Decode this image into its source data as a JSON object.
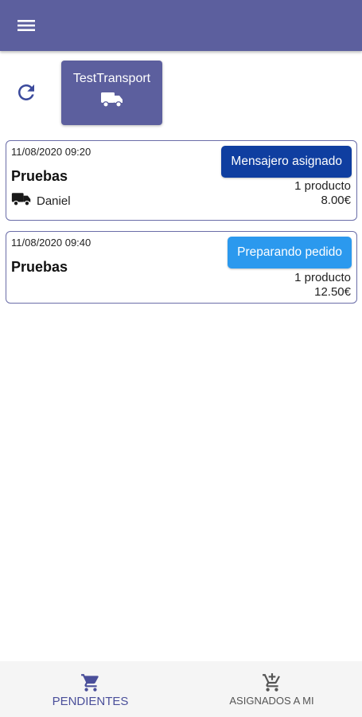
{
  "appbar": {
    "menu_icon": "menu-icon"
  },
  "toolbar": {
    "refresh_icon": "refresh-icon"
  },
  "transport": {
    "label": "TestTransport",
    "icon": "truck-icon"
  },
  "orders": [
    {
      "date": "11/08/2020 09:20",
      "name": "Pruebas",
      "status": "Mensajero asignado",
      "status_color": "#0f3ea0",
      "count": "1 producto",
      "price": "8.00€",
      "courier": "Daniel",
      "courier_icon": "truck-icon"
    },
    {
      "date": "11/08/2020 09:40",
      "name": "Pruebas",
      "status": "Preparando pedido",
      "status_color": "#2b99ee",
      "count": "1 producto",
      "price": "12.50€"
    }
  ],
  "bottom_nav": {
    "items": [
      {
        "label": "PENDIENTES",
        "icon": "cart-icon",
        "active": true
      },
      {
        "label": "ASIGNADOS A MI",
        "icon": "cart-add-icon",
        "active": false
      }
    ]
  },
  "colors": {
    "primary": "#5c5f9e",
    "assigned": "#0f3ea0",
    "preparing": "#2b99ee"
  }
}
